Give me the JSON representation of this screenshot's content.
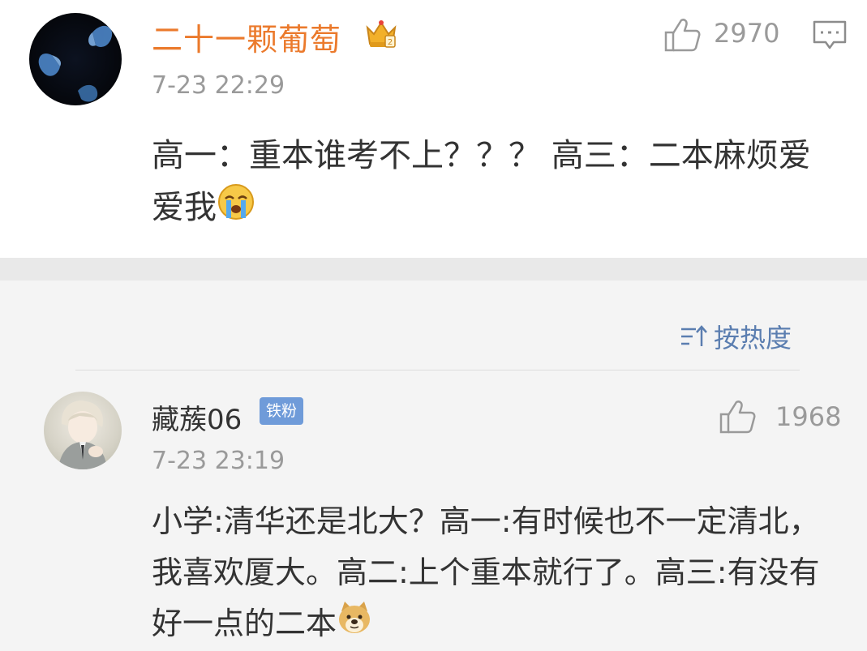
{
  "comment1": {
    "username": "二十一颗葡萄",
    "timestamp": "7-23 22:29",
    "like_count": "2970",
    "text": "高一：重本谁考不上？？？ 高三：二本麻烦爱爱我",
    "name_color": "#eb7a2c",
    "trailing_emoji": "crying-face-emoji"
  },
  "sort": {
    "label": "按热度"
  },
  "comment2": {
    "username": "藏蔟06",
    "badge": "铁粉",
    "timestamp": "7-23 23:19",
    "like_count": "1968",
    "text": "小学:清华还是北大？高一:有时候也不一定清北，我喜欢厦大。高二:上个重本就行了。高三:有没有好一点的二本",
    "badge_color": "#6f9bd9",
    "trailing_emoji": "doge-emoji"
  },
  "colors": {
    "link_blue": "#5b7eb0",
    "meta_gray": "#9a9a9a",
    "text": "#333333"
  }
}
